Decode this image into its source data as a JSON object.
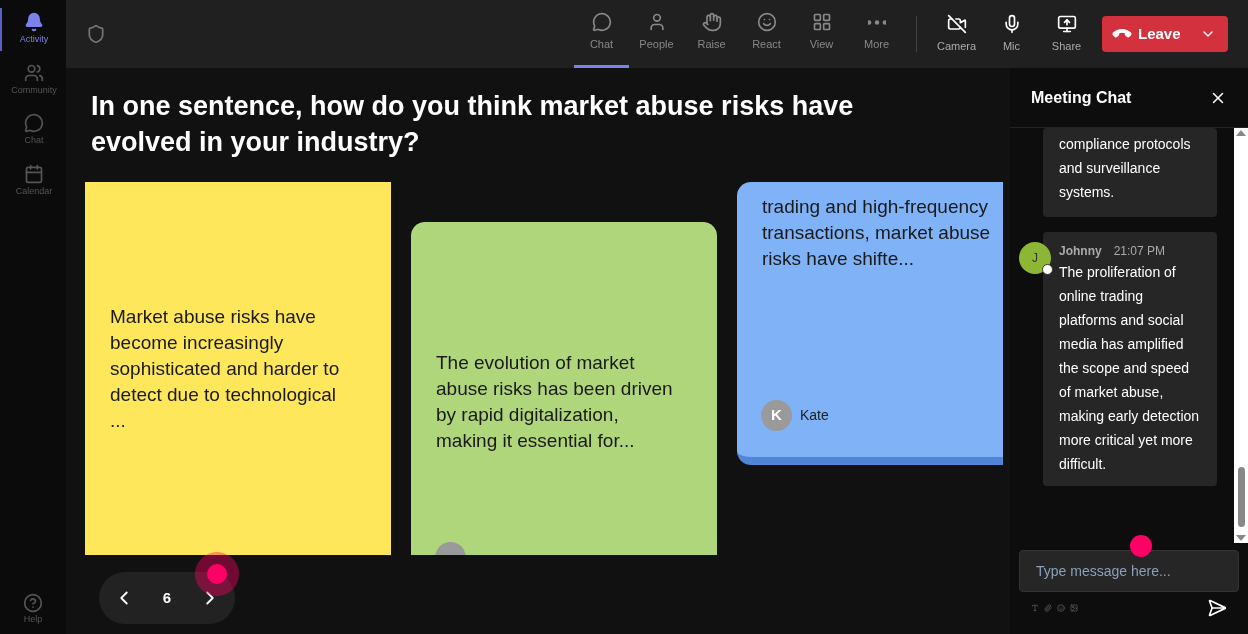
{
  "sidebar": {
    "items": [
      {
        "label": "Activity",
        "selected": true
      },
      {
        "label": "Community",
        "selected": false
      },
      {
        "label": "Chat",
        "selected": false
      },
      {
        "label": "Calendar",
        "selected": false
      }
    ],
    "help": "Help"
  },
  "toolbar": {
    "items": [
      {
        "label": "Chat",
        "selected": true
      },
      {
        "label": "People",
        "selected": false
      },
      {
        "label": "Raise",
        "selected": false
      },
      {
        "label": "React",
        "selected": false
      },
      {
        "label": "View",
        "selected": false
      },
      {
        "label": "More",
        "selected": false
      }
    ],
    "devices": [
      {
        "label": "Camera"
      },
      {
        "label": "Mic"
      },
      {
        "label": "Share"
      }
    ],
    "leave": "Leave"
  },
  "question": "In one sentence, how do you think market abuse risks have evolved in your industry?",
  "cards": [
    {
      "color": "#fee75b",
      "text": "Market abuse risks have become increasingly sophisticated and harder to detect due to technological ...",
      "has_avatar": false
    },
    {
      "color": "#b0d67c",
      "text": "The evolution of market abuse risks has been driven by rapid digitalization, making it essential for...",
      "has_avatar": true
    },
    {
      "color": "#7fb2f7",
      "text": "trading and high-frequency transactions, market abuse risks have shifte...",
      "has_avatar": true,
      "initial": "K",
      "name": "Kate"
    }
  ],
  "pager": {
    "page": "6"
  },
  "chat": {
    "title": "Meeting Chat",
    "messages": [
      {
        "text": "compliance protocols and surveillance systems."
      },
      {
        "author": "Johnny",
        "time": "21:07 PM",
        "initial": "J",
        "online": true,
        "text": "The proliferation of online trading platforms and social media has amplified the scope and speed of market abuse, making early detection more critical yet more difficult."
      }
    ],
    "input": {
      "placeholder": "Type message here..."
    }
  }
}
